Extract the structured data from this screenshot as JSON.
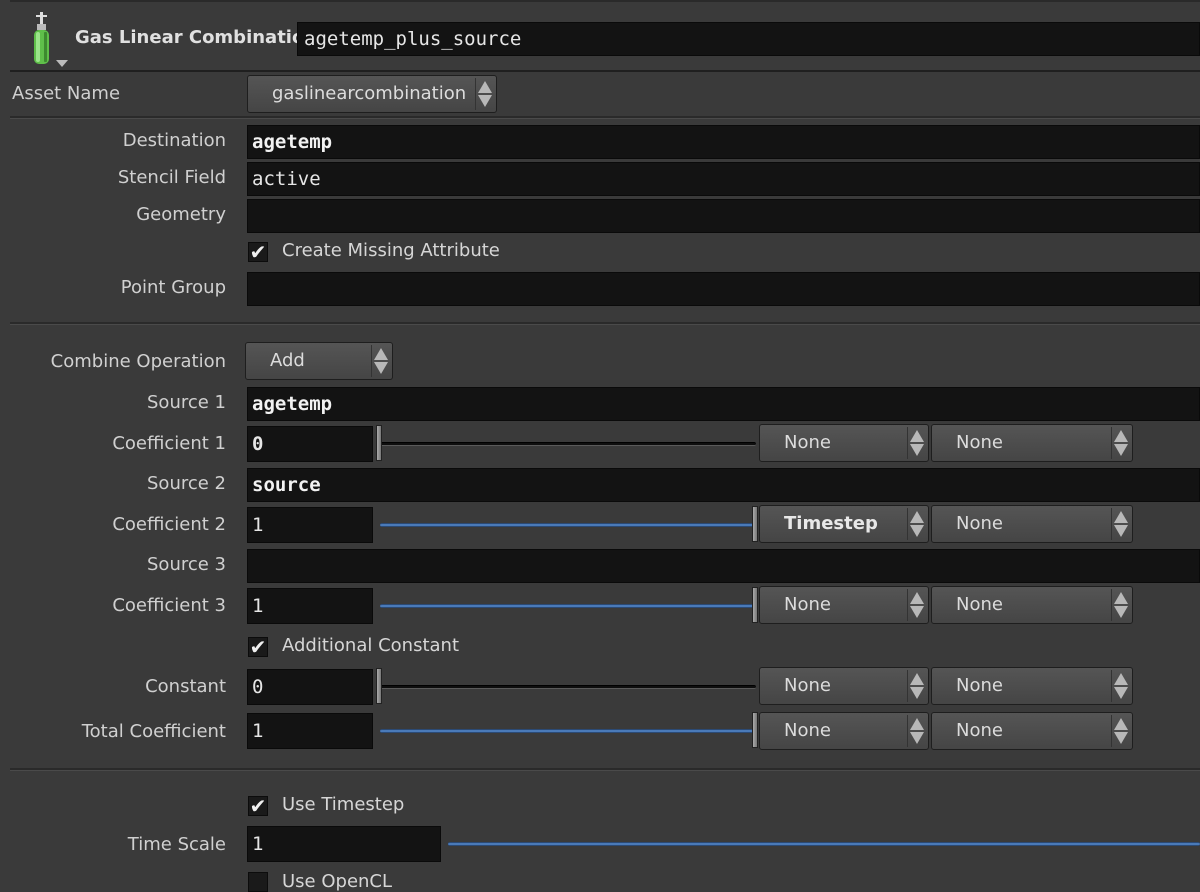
{
  "header": {
    "node_type": "Gas Linear Combination",
    "node_name": "agetemp_plus_source",
    "icon": "gas-tank-icon"
  },
  "asset": {
    "label": "Asset Name",
    "value": "gaslinearcombination"
  },
  "fields": {
    "destination": {
      "label": "Destination",
      "value": "agetemp"
    },
    "stencil": {
      "label": "Stencil Field",
      "value": "active"
    },
    "geometry": {
      "label": "Geometry",
      "value": ""
    },
    "create_missing": {
      "label": "Create Missing Attribute",
      "checked": true
    },
    "point_group": {
      "label": "Point Group",
      "value": ""
    }
  },
  "combine": {
    "label": "Combine Operation",
    "value": "Add"
  },
  "source1": {
    "label": "Source 1",
    "value": "agetemp"
  },
  "coef1": {
    "label": "Coefficient 1",
    "value": "0",
    "slider": 0,
    "menu_a": "None",
    "menu_b": "None"
  },
  "source2": {
    "label": "Source 2",
    "value": "source"
  },
  "coef2": {
    "label": "Coefficient 2",
    "value": "1",
    "slider": 1,
    "menu_a": "Timestep",
    "menu_b": "None"
  },
  "source3": {
    "label": "Source 3",
    "value": ""
  },
  "coef3": {
    "label": "Coefficient 3",
    "value": "1",
    "slider": 1,
    "menu_a": "None",
    "menu_b": "None"
  },
  "additional_constant": {
    "label": "Additional Constant",
    "checked": true
  },
  "constant": {
    "label": "Constant",
    "value": "0",
    "slider": 0,
    "menu_a": "None",
    "menu_b": "None"
  },
  "total_coef": {
    "label": "Total Coefficient",
    "value": "1",
    "slider": 1,
    "menu_a": "None",
    "menu_b": "None"
  },
  "use_timestep": {
    "label": "Use Timestep",
    "checked": true
  },
  "time_scale": {
    "label": "Time Scale",
    "value": "1"
  },
  "use_opencl": {
    "label": "Use OpenCL",
    "checked": false
  },
  "check_glyph": "✔",
  "colors": {
    "slider_blue": "#4a7ab8",
    "field_bg": "#131313",
    "panel_bg": "#3a3a3a"
  }
}
